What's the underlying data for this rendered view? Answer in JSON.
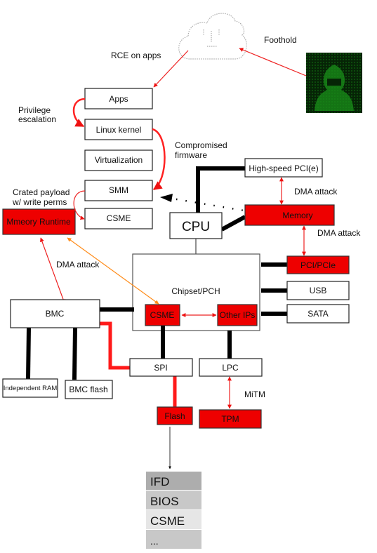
{
  "labels": {
    "foothold": "Foothold",
    "rce": "RCE on apps",
    "priv1": "Privilege",
    "priv2": "escalation",
    "comp1": "Compromised",
    "comp2": "firmware",
    "payload1": "Crated payload",
    "payload2": "w/ write perms",
    "dma1": "DMA attack",
    "dma2": "DMA attack",
    "dma3": "DMA attack",
    "mitm": "MiTM"
  },
  "boxes": {
    "apps": "Apps",
    "linux": "Linux kernel",
    "virt": "Virtualization",
    "smm": "SMM",
    "csme": "CSME",
    "runtime": "Mmeory Runtime",
    "hspci": "High-speed PCI(e)",
    "memory": "Memory",
    "cpu": "CPU",
    "chipset": "Chipset/PCH",
    "csme_inner": "CSME",
    "other_ips": "Other IPs",
    "pci": "PCI/PCIe",
    "usb": "USB",
    "sata": "SATA",
    "bmc": "BMC",
    "ram": "Independent RAM",
    "bmc_flash": "BMC flash",
    "spi": "SPI",
    "lpc": "LPC",
    "flash": "Flash",
    "tpm": "TPM"
  },
  "flash_layout": [
    "IFD",
    "BIOS",
    "CSME",
    "..."
  ],
  "colors": {
    "attacked": "#ee0000",
    "attack_arrow": "#ee2222",
    "orange_arrow": "#ff8c1a",
    "hacker_bg": "#062406",
    "hacker_fg": "#1fb51f"
  }
}
